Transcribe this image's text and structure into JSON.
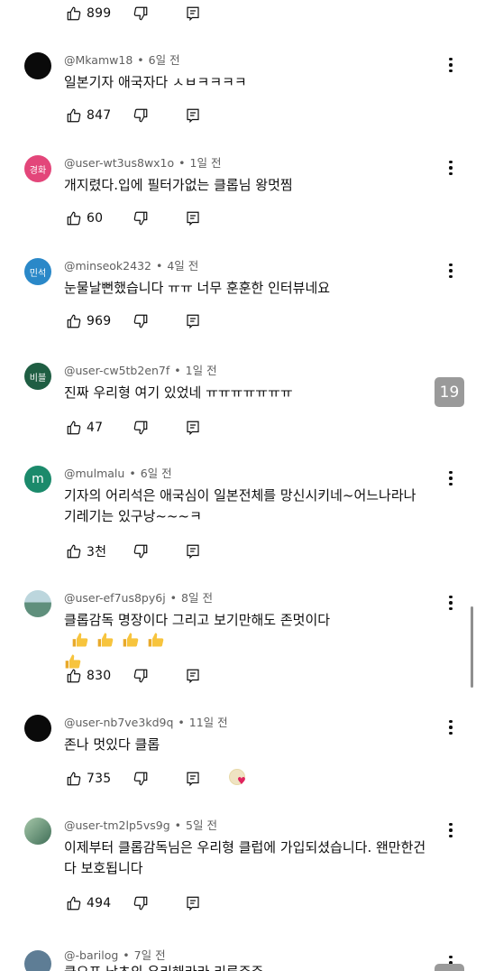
{
  "top_actions": {
    "like_count": "899"
  },
  "comments": [
    {
      "handle": "@Mkamw18",
      "time": "6일 전",
      "text": "일본기자 애국자다 ㅅㅂㅋㅋㅋㅋ",
      "likes": "847",
      "avatar_text": "",
      "avatar_color": "#0a0a0a"
    },
    {
      "handle": "@user-wt3us8wx1o",
      "time": "1일 전",
      "text": "개지렸다.입에 필터가없는 클롭님 왕멋찜",
      "likes": "60",
      "avatar_text": "경화",
      "avatar_color": "#e3467a"
    },
    {
      "handle": "@minseok2432",
      "time": "4일 전",
      "text": "눈물날뻔했습니다 ㅠㅠ 너무 훈훈한 인터뷰네요",
      "likes": "969",
      "avatar_text": "민석",
      "avatar_color": "#2a88c8"
    },
    {
      "handle": "@user-cw5tb2en7f",
      "time": "1일 전",
      "text": "진짜 우리형 여기 있었네 ㅠㅠㅠㅠㅠㅠㅠ",
      "likes": "47",
      "avatar_text": "비블",
      "avatar_color": "#1f5e43"
    },
    {
      "handle": "@mulmalu",
      "time": "6일 전",
      "text": "기자의 어리석은 애국심이 일본전체를 망신시키네~어느나라나\n기레기는 있구낭~~~ㅋ",
      "likes": "3천",
      "avatar_text": "m",
      "avatar_color": "#1b8a6b"
    },
    {
      "handle": "@user-ef7us8py6j",
      "time": "8일 전",
      "text": "클롭감독 명장이다 그리고 보기만해도 존멋이다",
      "likes": "830",
      "avatar_text": "",
      "avatar_color": "#7fa6b0"
    },
    {
      "handle": "@user-nb7ve3kd9q",
      "time": "11일 전",
      "text": "존나 멋있다 클롭",
      "likes": "735",
      "avatar_text": "",
      "avatar_color": "#0a0a0a"
    },
    {
      "handle": "@user-tm2lp5vs9g",
      "time": "5일 전",
      "text": "이제부터 클롭감독님은 우리형 클럽에 가입되셨습니다. 왠만한건\n다 보호됩니다",
      "likes": "494",
      "avatar_text": "",
      "avatar_color": "#6f8f75"
    }
  ],
  "partial_comment": {
    "handle": "@-barilog",
    "time": "7일 전",
    "text": "클오프 남초의 우리해라라 리루주주"
  },
  "scroll_position_badge": "19",
  "icons": {
    "like": "thumb-up-icon",
    "dislike": "thumb-down-icon",
    "reply": "reply-icon",
    "menu": "more-vert-icon",
    "emoji": "thumbs-up-emoji",
    "heart": "creator-heart-icon"
  },
  "colors": {
    "meta_text": "#606060",
    "main_text": "#0f0f0f",
    "badge_bg": "#9a9a9a"
  }
}
